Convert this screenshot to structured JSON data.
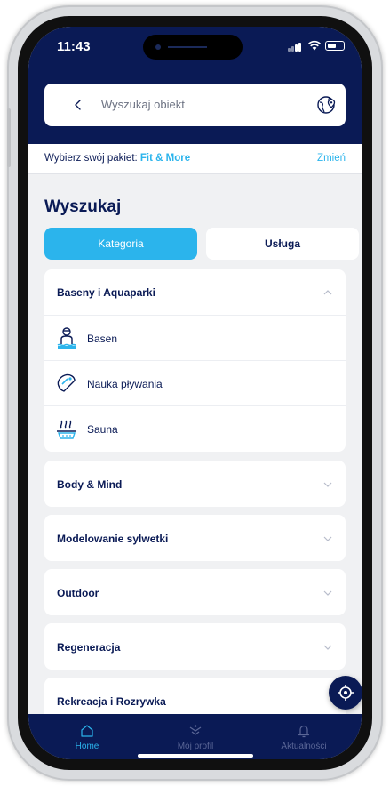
{
  "status_bar": {
    "time": "11:43"
  },
  "search": {
    "placeholder": "Wyszukaj obiekt",
    "back_icon": "chevron-left-icon",
    "map_icon": "globe-pin-icon"
  },
  "package": {
    "prefix": "Wybierz swój pakiet: ",
    "name": "Fit & More",
    "change": "Zmień"
  },
  "section": {
    "title": "Wyszukaj"
  },
  "segments": {
    "category": "Kategoria",
    "service": "Usługa",
    "active": "category"
  },
  "categories": [
    {
      "label": "Baseny i Aquaparki",
      "expanded": true,
      "items": [
        {
          "label": "Basen",
          "icon": "pool-icon"
        },
        {
          "label": "Nauka pływania",
          "icon": "swimming-cap-icon"
        },
        {
          "label": "Sauna",
          "icon": "sauna-icon"
        }
      ]
    },
    {
      "label": "Body & Mind",
      "expanded": false
    },
    {
      "label": "Modelowanie sylwetki",
      "expanded": false
    },
    {
      "label": "Outdoor",
      "expanded": false
    },
    {
      "label": "Regeneracja",
      "expanded": false
    },
    {
      "label": "Rekreacja i Rozrywka",
      "expanded": false
    }
  ],
  "tabbar": {
    "tabs": [
      {
        "label": "Home",
        "icon": "home-icon",
        "active": true
      },
      {
        "label": "Mój profil",
        "icon": "profile-icon",
        "active": false
      },
      {
        "label": "Aktualności",
        "icon": "bell-icon",
        "active": false
      }
    ]
  },
  "colors": {
    "navy": "#0a1a55",
    "accent": "#2bb4ec",
    "background": "#f0f1f3"
  }
}
